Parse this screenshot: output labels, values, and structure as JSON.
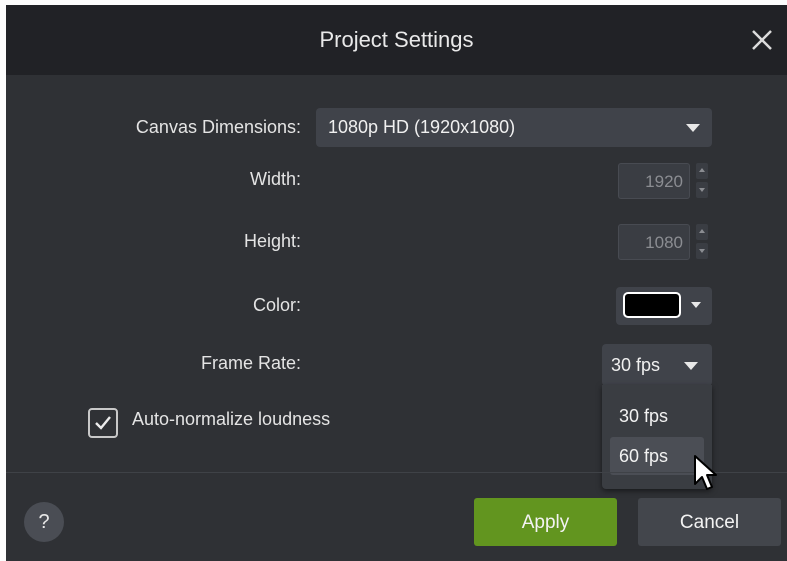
{
  "dialog": {
    "title": "Project Settings"
  },
  "canvas": {
    "label": "Canvas Dimensions:",
    "selected": "1080p HD (1920x1080)"
  },
  "width": {
    "label": "Width:",
    "value": "1920"
  },
  "height": {
    "label": "Height:",
    "value": "1080"
  },
  "color": {
    "label": "Color:",
    "value": "#000000"
  },
  "frame_rate": {
    "label": "Frame Rate:",
    "selected": "30 fps",
    "options": [
      "30 fps",
      "60 fps"
    ],
    "hovered": "60 fps"
  },
  "loudness": {
    "label": "Auto-normalize loudness",
    "checked": true
  },
  "footer": {
    "help": "?",
    "apply": "Apply",
    "cancel": "Cancel"
  },
  "icons": [
    "close-icon",
    "chevron-down-icon",
    "checkmark-icon",
    "mouse-cursor-icon"
  ],
  "colors": {
    "accent": "#62951f",
    "background": "#2f3135",
    "titlebar": "#212226"
  }
}
